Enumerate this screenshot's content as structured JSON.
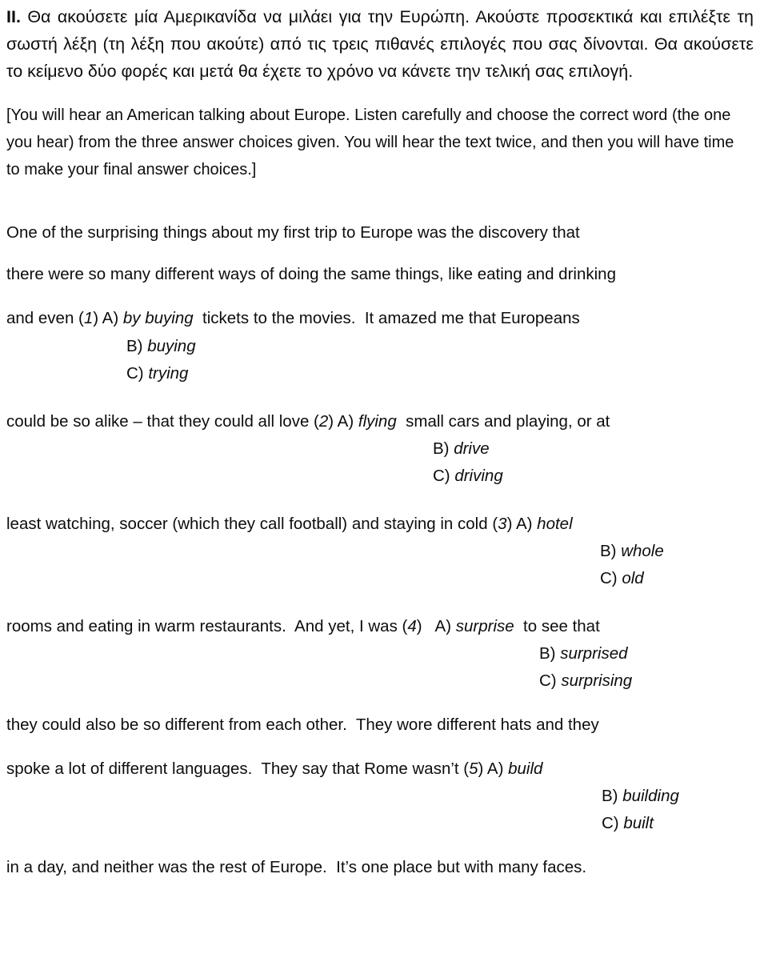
{
  "document": {
    "section_number": "II.",
    "instructions_greek": "Θα ακούσετε μία Αμερικανίδα να μιλάει για την Ευρώπη. Ακούστε προσεκτικά και επιλέξτε τη σωστή λέξη (τη λέξη που ακούτε) από τις τρεις πιθανές επιλογές που σας δίνονται. Θα ακούσετε το κείμενο δύο φορές και μετά θα έχετε το χρόνο να κάνετε την τελική σας επιλογή.",
    "instructions_english": "[You will hear an American talking about Europe. Listen carefully and choose the correct word (the one you hear) from the three answer choices given. You will hear the text twice, and then you will have time to make your final answer choices.]",
    "passage": {
      "line_1": "One of the surprising things about my first trip to Europe was the discovery that",
      "line_2": "there were so many different ways of doing the same things, like eating and drinking",
      "line_3_before": "and even (",
      "line_3_num": "1",
      "line_3_mid": ") A) ",
      "line_3_answer_a": "by buying",
      "line_3_after": "  tickets to the movies.  It amazed me that Europeans",
      "line_4_before": "could be so alike – that they could all love (",
      "line_4_num": "2",
      "line_4_mid": ") A) ",
      "line_4_answer_a": "flying",
      "line_4_after": "  small cars and playing, or at",
      "line_5_before": "least watching, soccer (which they call football) and staying in cold (",
      "line_5_num": "3",
      "line_5_mid": ") A) ",
      "line_5_answer_a": "hotel",
      "line_5_after": "",
      "line_6_before": "rooms and eating in warm restaurants.  And yet, I was (",
      "line_6_num": "4",
      "line_6_mid": ")   A) ",
      "line_6_answer_a": "surprise",
      "line_6_after": "  to see that",
      "line_7": "they could also be so different from each other.  They wore different hats and they",
      "line_8_before": "spoke a lot of different languages.  They say that Rome wasn’t (",
      "line_8_num": "5",
      "line_8_mid": ") A) ",
      "line_8_answer_a": "build",
      "line_8_after": "",
      "line_9": "in a day, and neither was the rest of Europe.  It’s one place but with many faces."
    },
    "questions": [
      {
        "number": "1",
        "option_a": "by buying",
        "option_b_label": "B) ",
        "option_b": "buying",
        "option_c_label": "C) ",
        "option_c": "trying"
      },
      {
        "number": "2",
        "option_a": "flying",
        "option_b_label": "B) ",
        "option_b": "drive",
        "option_c_label": "C) ",
        "option_c": "driving"
      },
      {
        "number": "3",
        "option_a": "hotel",
        "option_b_label": "B) ",
        "option_b": "whole",
        "option_c_label": "C) ",
        "option_c": "old"
      },
      {
        "number": "4",
        "option_a": "surprise",
        "option_b_label": "B) ",
        "option_b": "surprised",
        "option_c_label": "C) ",
        "option_c": "surprising"
      },
      {
        "number": "5",
        "option_a": "build",
        "option_b_label": "B) ",
        "option_b": "building",
        "option_c_label": "C) ",
        "option_c": "built"
      }
    ]
  }
}
